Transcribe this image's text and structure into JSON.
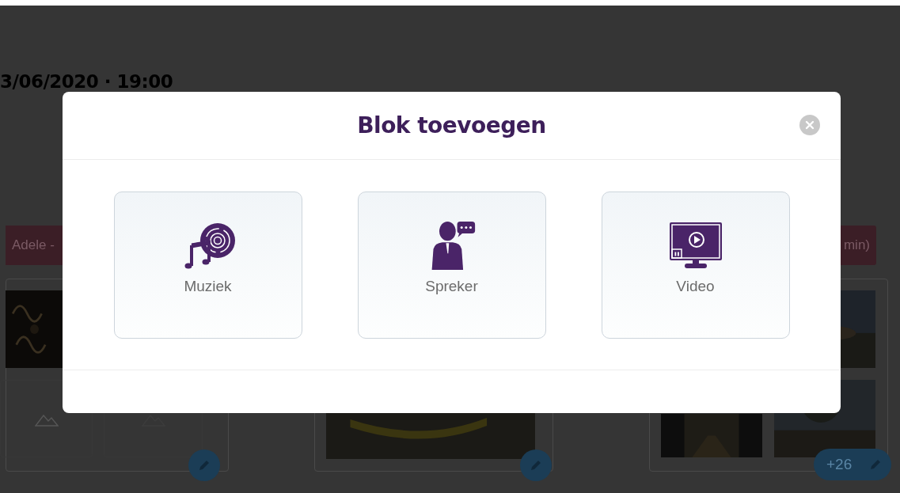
{
  "background": {
    "date_time": "3/06/2020 · 19:00",
    "tags": [
      {
        "label": "Adele -"
      },
      {
        "label": "min)"
      }
    ],
    "photo_count": "+26"
  },
  "dialog": {
    "title": "Blok toevoegen",
    "options": [
      {
        "kind": "music",
        "label": "Muziek"
      },
      {
        "kind": "speaker",
        "label": "Spreker"
      },
      {
        "kind": "video",
        "label": "Video"
      }
    ]
  }
}
